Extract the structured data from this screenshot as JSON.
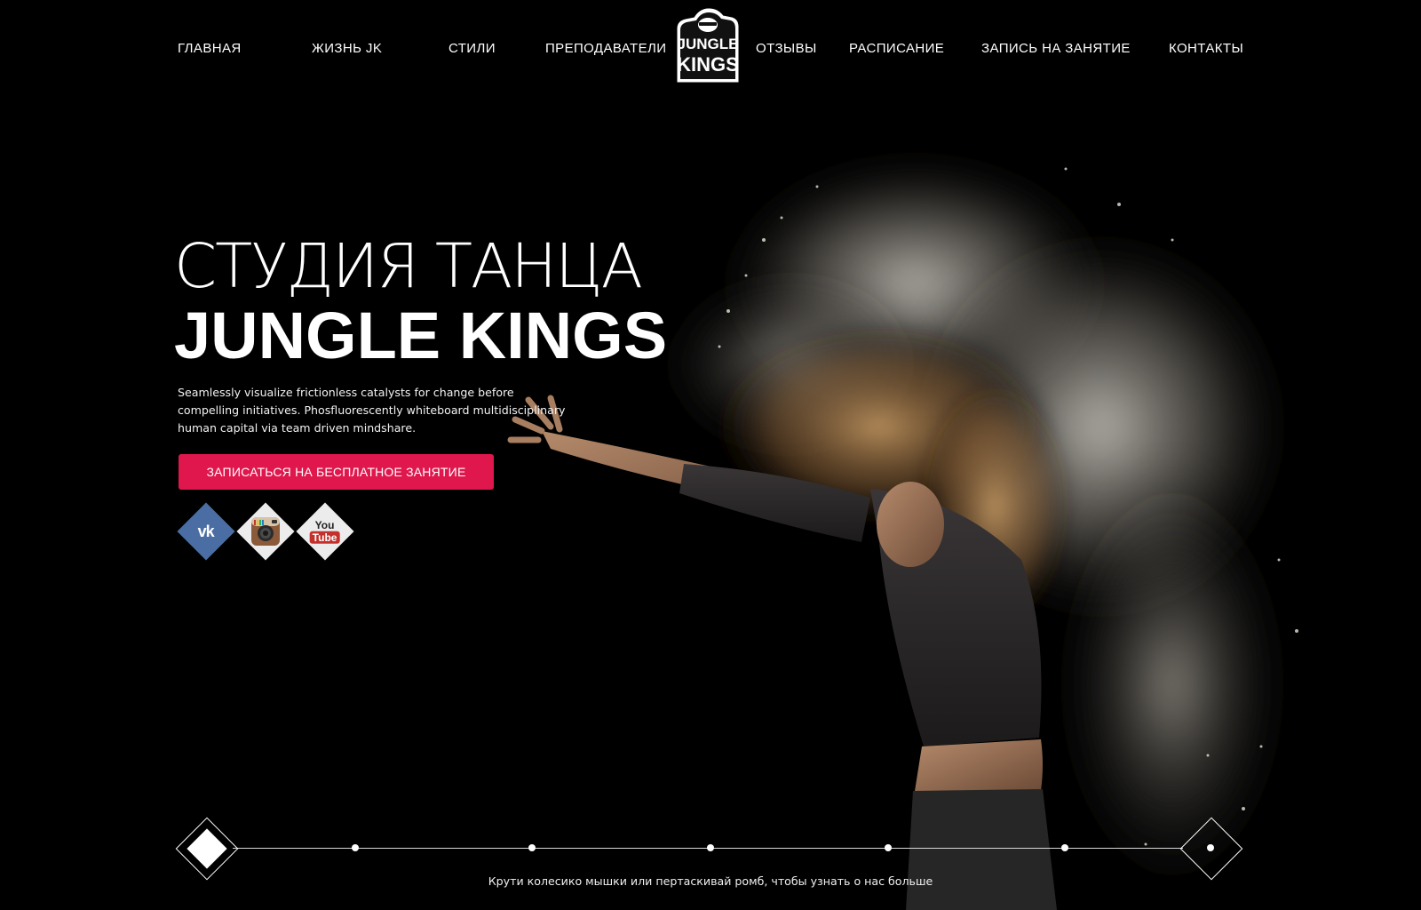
{
  "brand": {
    "logo_top": "JUNGLE",
    "logo_bottom": "KINGS"
  },
  "nav": {
    "items": [
      {
        "label": "Главная"
      },
      {
        "label": "Жизнь JK"
      },
      {
        "label": "Стили"
      },
      {
        "label": "Преподаватели"
      },
      {
        "label": "Отзывы"
      },
      {
        "label": "Расписание"
      },
      {
        "label": "Запись на занятие"
      },
      {
        "label": "Контакты"
      }
    ]
  },
  "hero": {
    "title_line1": "СТУДИЯ ТАНЦА",
    "title_line2": "JUNGLE KINGS",
    "description": "Seamlessly visualize frictionless catalysts for change before compelling initiatives. Phosfluorescently whiteboard multidisciplinary human capital via team driven mindshare.",
    "cta_label": "Записаться на бесплатное занятие"
  },
  "social": {
    "vk": {
      "icon": "vk-icon",
      "text": "vk",
      "color": "#4a6ea3"
    },
    "instagram": {
      "icon": "instagram-icon"
    },
    "youtube": {
      "icon": "youtube-icon",
      "text_top": "You",
      "text_bottom": "Tube",
      "color": "#c4302b"
    }
  },
  "scroller": {
    "hint": "Крути колесико мышки или пертаскивай ромб, чтобы узнать о нас больше",
    "steps_total": 6,
    "current_step": 1
  },
  "colors": {
    "background": "#000000",
    "accent": "#e0174d",
    "text": "#ffffff"
  }
}
